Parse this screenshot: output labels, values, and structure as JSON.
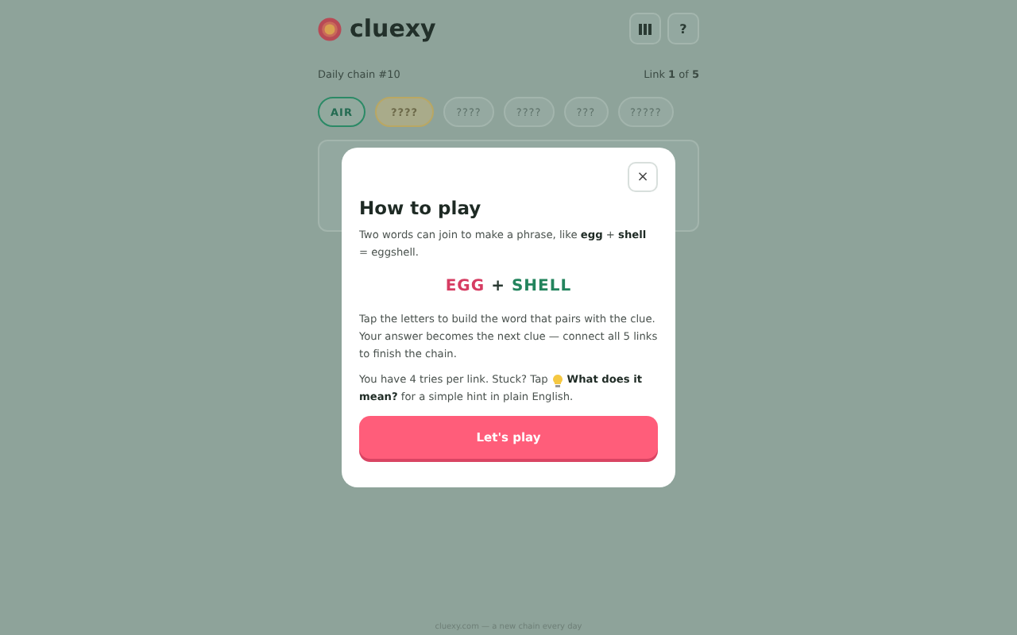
{
  "header": {
    "logo": "cluexy",
    "help_button": "?"
  },
  "chain_info": {
    "title": "Daily chain #10",
    "progress": "Link **1** of **5**"
  },
  "chain": [
    {
      "label": "AIR",
      "solved": true,
      "selected": false
    },
    {
      "label": "????",
      "solved": false,
      "selected": true
    },
    {
      "label": "????",
      "solved": false,
      "selected": false
    },
    {
      "label": "????",
      "solved": false,
      "selected": false
    },
    {
      "label": "???",
      "solved": false,
      "selected": false
    },
    {
      "label": "?????",
      "solved": false,
      "selected": false
    }
  ],
  "dialog": {
    "close": "×",
    "title": "How to play",
    "intro": "Two words can join to make a phrase, like **egg** + **shell** = eggshell.",
    "example": {
      "first": "EGG",
      "plus": "+",
      "second": "SHELL"
    },
    "rules": "Tap the letters to build the word that pairs with the clue. Your answer becomes the next clue — connect all 5 links to finish the chain.",
    "hint_before": "You have 4 tries per link. Stuck? Tap",
    "hint_after": "**What does it**",
    "hint_end": "**mean?** for a simple hint in plain English.",
    "button": "Let's play"
  },
  "footer": "cluexy.com — a new chain every day"
}
